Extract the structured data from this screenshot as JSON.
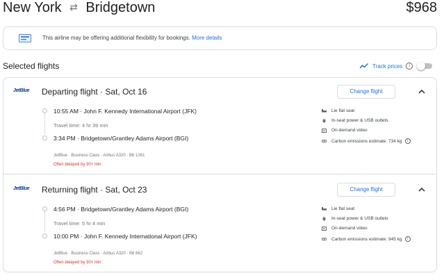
{
  "header": {
    "origin": "New York",
    "swap_icon": "two-way-arrow-icon",
    "destination": "Bridgetown",
    "price": "$968"
  },
  "notice": {
    "icon": "ticket-icon",
    "text": "This airline may be offering additional flexibility for bookings.",
    "link": "More details"
  },
  "selected": {
    "title": "Selected flights",
    "track_label": "Track prices",
    "track_enabled": false
  },
  "flights": [
    {
      "airline_logo": "JetBlue",
      "title": "Departing flight",
      "date": "Sat, Oct 16",
      "change_label": "Change flight",
      "depart_time": "10:55 AM",
      "depart_airport": "John F. Kennedy International Airport (JFK)",
      "travel_time": "Travel time: 4 hr 39 min",
      "arrive_time": "3:34 PM",
      "arrive_airport": "Bridgetown/Grantley Adams Airport (BGI)",
      "meta": "JetBlue · Business Class · Airbus A320 · B6 1261",
      "delay": "Often delayed by 30+ min",
      "amenities": [
        {
          "icon": "lie-flat-seat-icon",
          "label": "Lie flat seat"
        },
        {
          "icon": "power-plug-icon",
          "label": "In-seat power & USB outlets"
        },
        {
          "icon": "video-icon",
          "label": "On-demand video"
        },
        {
          "icon": "co2-icon",
          "label": "Carbon emissions estimate: 734 kg"
        }
      ]
    },
    {
      "airline_logo": "JetBlue",
      "title": "Returning flight",
      "date": "Sat, Oct 23",
      "change_label": "Change flight",
      "depart_time": "4:56 PM",
      "depart_airport": "Bridgetown/Grantley Adams Airport (BGI)",
      "travel_time": "Travel time: 5 hr 4 min",
      "arrive_time": "10:00 PM",
      "arrive_airport": "John F. Kennedy International Airport (JFK)",
      "meta": "JetBlue · Business Class · Airbus A320 · B6 662",
      "delay": "Often delayed by 30+ min",
      "amenities": [
        {
          "icon": "lie-flat-seat-icon",
          "label": "Lie flat seat"
        },
        {
          "icon": "power-plug-icon",
          "label": "In-seat power & USB outlets"
        },
        {
          "icon": "video-icon",
          "label": "On-demand video"
        },
        {
          "icon": "co2-icon",
          "label": "Carbon emissions estimate: 945 kg"
        }
      ]
    }
  ],
  "colors": {
    "accent": "#1a73e8",
    "text": "#202124",
    "secondary_text": "#70757a",
    "border": "#dadce0",
    "delay": "#d93025",
    "jetblue": "#0033a0"
  }
}
